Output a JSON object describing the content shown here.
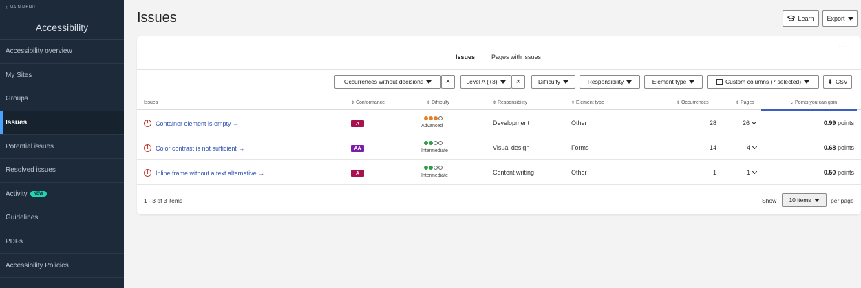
{
  "sidebar": {
    "main_menu": "MAIN MENU",
    "title": "Accessibility",
    "items": [
      {
        "label": "Accessibility overview"
      },
      {
        "label": "My Sites"
      },
      {
        "label": "Groups"
      },
      {
        "label": "Issues",
        "active": true
      },
      {
        "label": "Potential issues"
      },
      {
        "label": "Resolved issues"
      },
      {
        "label": "Activity",
        "badge": "NEW"
      },
      {
        "label": "Guidelines"
      },
      {
        "label": "PDFs"
      },
      {
        "label": "Accessibility Policies"
      }
    ]
  },
  "header": {
    "title": "Issues",
    "learn_label": "Learn",
    "export_label": "Export"
  },
  "card": {
    "more_label": "···",
    "tabs": [
      {
        "label": "Issues",
        "active": true
      },
      {
        "label": "Pages with issues"
      }
    ],
    "filters": {
      "occurrences": "Occurrences without decisions",
      "level": "Level A (+3)",
      "difficulty": "Difficulty",
      "responsibility": "Responsibility",
      "element_type": "Element type",
      "custom_columns": "Custom columns (7 selected)",
      "csv": "CSV"
    },
    "columns": {
      "issues": "Issues",
      "conformance": "Conformance",
      "difficulty": "Difficulty",
      "responsibility": "Responsibility",
      "element_type": "Element type",
      "occurrences": "Occurrences",
      "pages": "Pages",
      "points": "Points you can gain"
    },
    "rows": [
      {
        "issue": "Container element is empty →",
        "conformance": "A",
        "conf_color": "#a8134f",
        "difficulty": "Advanced",
        "responsibility": "Development",
        "element_type": "Other",
        "occurrences": "28",
        "pages": "26",
        "points_value": "0.99",
        "points_unit": "points"
      },
      {
        "issue": "Color contrast is not sufficient →",
        "conformance": "AA",
        "conf_color": "#7a1fa8",
        "difficulty": "Intermediate",
        "responsibility": "Visual design",
        "element_type": "Forms",
        "occurrences": "14",
        "pages": "4",
        "points_value": "0.68",
        "points_unit": "points"
      },
      {
        "issue": "Inline frame without a text alternative →",
        "conformance": "A",
        "conf_color": "#a8134f",
        "difficulty": "Intermediate",
        "responsibility": "Content writing",
        "element_type": "Other",
        "occurrences": "1",
        "pages": "1",
        "points_value": "0.50",
        "points_unit": "points"
      }
    ],
    "footer": {
      "items_count": "1 - 3 of 3 items",
      "show_label": "Show",
      "per_page_value": "10 items",
      "per_page_label": "per page"
    }
  },
  "colors": {
    "sidebar_bg": "#1d2a3a",
    "accent": "#3b5fc0",
    "link": "#2f56b0",
    "warning": "#c0392b",
    "dot_green": "#2e9e47",
    "dot_orange": "#e67e22"
  }
}
